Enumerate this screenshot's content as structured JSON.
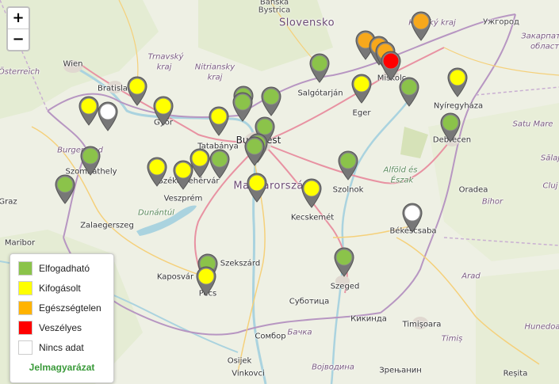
{
  "zoom": {
    "in_label": "+",
    "out_label": "−"
  },
  "legend": {
    "title": "Jelmagyarázat",
    "items": [
      {
        "label": "Elfogadható",
        "color": "#8bc34a"
      },
      {
        "label": "Kifogásolt",
        "color": "#ffff00"
      },
      {
        "label": "Egészségtelen",
        "color": "#ffb300"
      },
      {
        "label": "Veszélyes",
        "color": "#ff0000"
      },
      {
        "label": "Nincs adat",
        "color": "#ffffff"
      }
    ]
  },
  "status_colors": {
    "green": "#8bc34a",
    "yellow": "#ffff00",
    "orange": "#f7a81b",
    "red": "#ff0000",
    "white": "#ffffff"
  },
  "labels": {
    "banska": "Banská",
    "bystrica": "Bystrica",
    "slovensko": "Slovensko",
    "uzhorod": "Ужгород",
    "zakarpat1": "Закарпат",
    "zakarpat2": "область",
    "kosicky": "Košický kraj",
    "wien": "Wien",
    "osterreich": "Österreich",
    "bratislava": "Bratislava",
    "trnavsky1": "Trnavský",
    "trnavsky2": "kraj",
    "nitriansky1": "Nitriansky",
    "nitriansky2": "kraj",
    "salgotarjan": "Salgótarján",
    "miskolc": "Miskolc",
    "eger": "Eger",
    "nyiregyhaza": "Nyíregyháza",
    "gyor": "Győr",
    "tatabanya": "Tatabánya",
    "budapest": "Budapest",
    "debrecen": "Debrecen",
    "satumare": "Satu Mare",
    "burgenland": "Burgenland",
    "szombathely": "Szombathely",
    "szekesfehervar": "Székesfehérvár",
    "magyarorszag": "Magyarország",
    "szolnok": "Szolnok",
    "alfold1": "Alföld és",
    "alfold2": "Észak",
    "oradea": "Oradea",
    "bihor": "Bihor",
    "veszprem": "Veszprém",
    "kecskemet": "Kecskemét",
    "graz": "Graz",
    "zalaegerszeg": "Zalaegerszeg",
    "dunantul": "Dunántúl",
    "bekescsaba": "Békéscsaba",
    "maribor": "Maribor",
    "szekszard": "Szekszárd",
    "kaposvar": "Kaposvár",
    "pecs": "Pécs",
    "szeged": "Szeged",
    "arad": "Arad",
    "subotica": "Суботица",
    "kikinda": "Кикинда",
    "timisoara": "Timișoara",
    "timis": "Timiș",
    "hunedoara": "Hunedoa",
    "sombor": "Сомбор",
    "osijek": "Osijek",
    "vinkovci": "Vinkovci",
    "vojvodina": "Војводина",
    "zrenjanin": "Зрењанин",
    "resita": "Reșita",
    "cluj": "Cluj",
    "sala": "Sălaj",
    "bacs": "Бачка"
  },
  "markers": [
    {
      "id": "kosice",
      "status": "orange"
    },
    {
      "id": "ne-orange-1",
      "status": "orange"
    },
    {
      "id": "ne-orange-2",
      "status": "orange"
    },
    {
      "id": "ne-orange-3",
      "status": "orange"
    },
    {
      "id": "miskolc",
      "status": "red"
    },
    {
      "id": "salgotarjan",
      "status": "green"
    },
    {
      "id": "eger",
      "status": "yellow"
    },
    {
      "id": "miskolc-east",
      "status": "green"
    },
    {
      "id": "nyiregyhaza",
      "status": "yellow"
    },
    {
      "id": "debrecen",
      "status": "green"
    },
    {
      "id": "bratislava-east",
      "status": "yellow"
    },
    {
      "id": "mosonmagyarovar",
      "status": "yellow"
    },
    {
      "id": "hegyeshalom",
      "status": "white"
    },
    {
      "id": "gyor",
      "status": "yellow"
    },
    {
      "id": "tatabanya",
      "status": "yellow"
    },
    {
      "id": "dunakeszi",
      "status": "green"
    },
    {
      "id": "vac",
      "status": "green"
    },
    {
      "id": "budapest-north",
      "status": "green"
    },
    {
      "id": "budapest-centre",
      "status": "green"
    },
    {
      "id": "budapest-south",
      "status": "green"
    },
    {
      "id": "szazhalombatta",
      "status": "green"
    },
    {
      "id": "szombathely",
      "status": "green"
    },
    {
      "id": "sopron-south",
      "status": "green"
    },
    {
      "id": "ajka",
      "status": "yellow"
    },
    {
      "id": "veszprem",
      "status": "yellow"
    },
    {
      "id": "szekesfehervar",
      "status": "yellow"
    },
    {
      "id": "szekesfehervar-east",
      "status": "green"
    },
    {
      "id": "dunaujvaros",
      "status": "yellow"
    },
    {
      "id": "kecskemet",
      "status": "yellow"
    },
    {
      "id": "szolnok",
      "status": "green"
    },
    {
      "id": "bekescsaba",
      "status": "white"
    },
    {
      "id": "szeged",
      "status": "green"
    },
    {
      "id": "pecs-north",
      "status": "green"
    },
    {
      "id": "pecs",
      "status": "yellow"
    }
  ]
}
